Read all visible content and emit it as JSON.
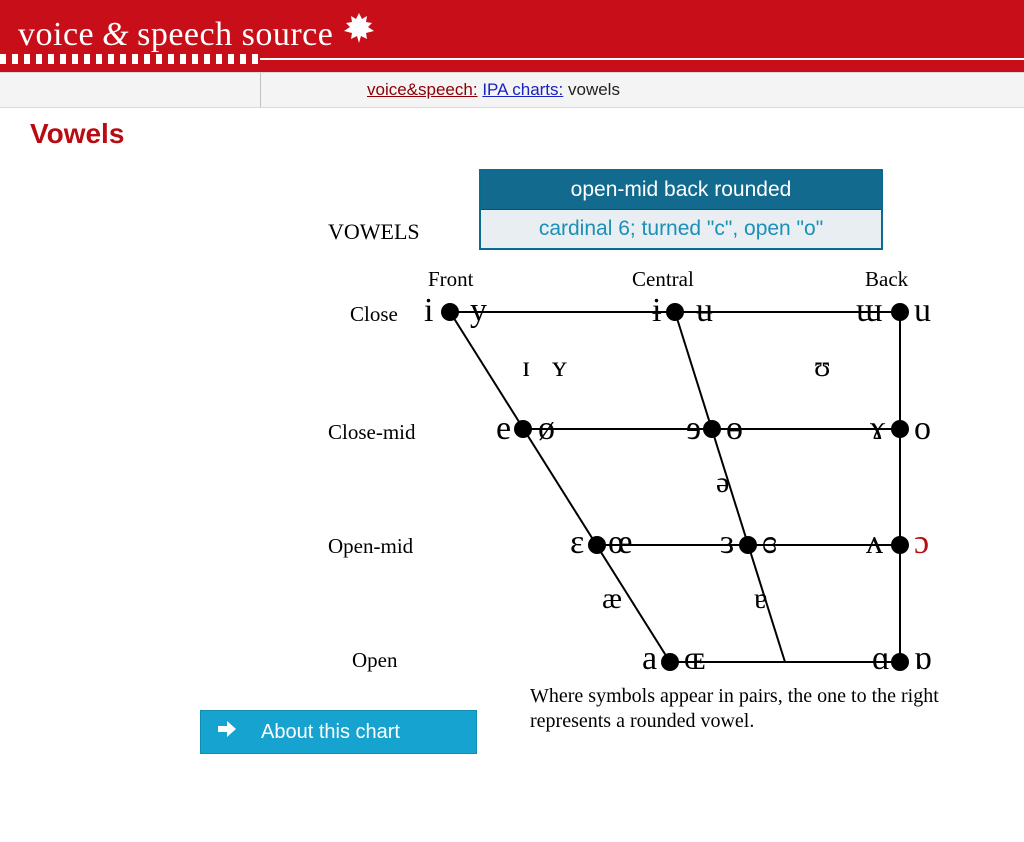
{
  "banner": {
    "title_left": "voice",
    "title_amp": "&",
    "title_right": "speech source"
  },
  "breadcrumbs": {
    "home": "voice&speech:",
    "section": "IPA charts:",
    "current": "vowels"
  },
  "page_title": "Vowels",
  "chart_heading": "VOWELS",
  "tooltip": {
    "line1": "open-mid back rounded",
    "line2": "cardinal 6; turned \"c\", open \"o\""
  },
  "columns": {
    "front": "Front",
    "central": "Central",
    "back": "Back"
  },
  "rows": {
    "close": "Close",
    "close_mid": "Close-mid",
    "open_mid": "Open-mid",
    "open": "Open"
  },
  "vowels": {
    "i": "i",
    "y": "y",
    "barred_i": "ɨ",
    "barred_u": "ʉ",
    "turned_m": "ɯ",
    "u": "u",
    "cap_i": "ɪ",
    "cap_y": "ʏ",
    "upsilon": "ʊ",
    "e": "e",
    "o_slash": "ø",
    "rev_e": "ɘ",
    "barred_o": "ɵ",
    "rams_horn": "ɤ",
    "o": "o",
    "schwa": "ə",
    "eps": "ɛ",
    "oe": "œ",
    "rev_eps": "ɜ",
    "closed_rev_eps": "ɞ",
    "turned_v": "ʌ",
    "open_o": "ɔ",
    "ae": "æ",
    "turned_a": "ɐ",
    "a": "a",
    "cap_oe": "ɶ",
    "script_a": "ɑ",
    "turned_script_a": "ɒ"
  },
  "footnote": "Where symbols appear in pairs, the one to the right represents a rounded vowel.",
  "about_button": "About this chart",
  "chart_data": {
    "type": "trapezoid-diagram",
    "title": "IPA Vowel Chart",
    "columns": [
      "Front",
      "Central",
      "Back"
    ],
    "rows": [
      "Close",
      "Close-mid",
      "Open-mid",
      "Open"
    ],
    "highlighted": {
      "symbol": "ɔ",
      "description": "open-mid back rounded",
      "names": "cardinal 6; turned \"c\", open \"o\""
    },
    "nodes": [
      {
        "row": "Close",
        "col": "Front",
        "unrounded": "i",
        "rounded": "y"
      },
      {
        "row": "Close",
        "col": "Central",
        "unrounded": "ɨ",
        "rounded": "ʉ"
      },
      {
        "row": "Close",
        "col": "Back",
        "unrounded": "ɯ",
        "rounded": "u"
      },
      {
        "row": "Close-mid",
        "col": "Front",
        "unrounded": "e",
        "rounded": "ø"
      },
      {
        "row": "Close-mid",
        "col": "Central",
        "unrounded": "ɘ",
        "rounded": "ɵ"
      },
      {
        "row": "Close-mid",
        "col": "Back",
        "unrounded": "ɤ",
        "rounded": "o"
      },
      {
        "row": "Open-mid",
        "col": "Front",
        "unrounded": "ɛ",
        "rounded": "œ"
      },
      {
        "row": "Open-mid",
        "col": "Central",
        "unrounded": "ɜ",
        "rounded": "ɞ"
      },
      {
        "row": "Open-mid",
        "col": "Back",
        "unrounded": "ʌ",
        "rounded": "ɔ"
      },
      {
        "row": "Open",
        "col": "Front",
        "unrounded": "a",
        "rounded": "ɶ"
      },
      {
        "row": "Open",
        "col": "Back",
        "unrounded": "ɑ",
        "rounded": "ɒ"
      }
    ],
    "loose": [
      {
        "between_rows": [
          "Close",
          "Close-mid"
        ],
        "near_col": "Front",
        "symbols": [
          "ɪ",
          "ʏ"
        ]
      },
      {
        "between_rows": [
          "Close",
          "Close-mid"
        ],
        "near_col": "Back",
        "symbols": [
          "ʊ"
        ]
      },
      {
        "between_rows": [
          "Close-mid",
          "Open-mid"
        ],
        "near_col": "Central",
        "symbols": [
          "ə"
        ]
      },
      {
        "between_rows": [
          "Open-mid",
          "Open"
        ],
        "near_col": "Front",
        "symbols": [
          "æ"
        ]
      },
      {
        "between_rows": [
          "Open-mid",
          "Open"
        ],
        "near_col": "Central",
        "symbols": [
          "ɐ"
        ]
      }
    ],
    "note": "Where symbols appear in pairs, the one to the right represents a rounded vowel."
  }
}
